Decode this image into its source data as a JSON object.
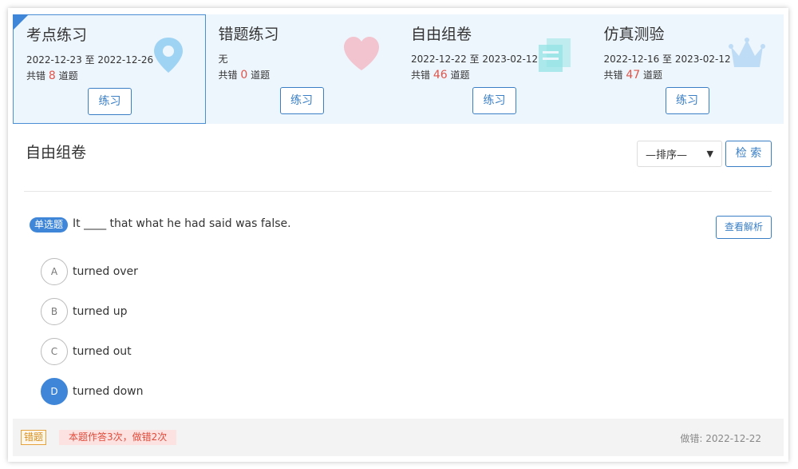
{
  "cards": [
    {
      "title": "考点练习",
      "date": "2022-12-23 至 2022-12-26",
      "count_prefix": "共错 ",
      "count": "8",
      "count_suffix": " 道题",
      "button": "练习",
      "icon": "location-pin-icon",
      "icon_color": "#5fb7ec"
    },
    {
      "title": "错题练习",
      "date": "无",
      "count_prefix": "共错 ",
      "count": "0",
      "count_suffix": " 道题",
      "button": "练习",
      "icon": "heart-icon",
      "icon_color": "#f3b8c3"
    },
    {
      "title": "自由组卷",
      "date": "2022-12-22 至 2023-02-12",
      "count_prefix": "共错 ",
      "count": "46",
      "count_suffix": " 道题",
      "button": "练习",
      "icon": "stacked-papers-icon",
      "icon_color": "#8fe2e2"
    },
    {
      "title": "仿真测验",
      "date": "2022-12-16 至 2023-02-12",
      "count_prefix": "共错 ",
      "count": "47",
      "count_suffix": " 道题",
      "button": "练习",
      "icon": "crown-icon",
      "icon_color": "#bfdcf6"
    }
  ],
  "section": {
    "title": "自由组卷",
    "sort_selected": "—排序—",
    "search_label": "检 索"
  },
  "question": {
    "type_label": "单选题",
    "text": "It ____ that what he had said was false.",
    "analysis_label": "查看解析",
    "options": [
      {
        "letter": "A",
        "text": "turned over",
        "selected": false
      },
      {
        "letter": "B",
        "text": "turned up",
        "selected": false
      },
      {
        "letter": "C",
        "text": "turned out",
        "selected": false
      },
      {
        "letter": "D",
        "text": "turned down",
        "selected": true
      }
    ]
  },
  "footer": {
    "wrong_tag": "错题",
    "stats": "本题作答3次，做错2次",
    "date": "做错: 2022-12-22"
  },
  "colors": {
    "accent": "#3f86d9",
    "card_bg": "#eef6fd",
    "error_red": "#e0544a"
  }
}
